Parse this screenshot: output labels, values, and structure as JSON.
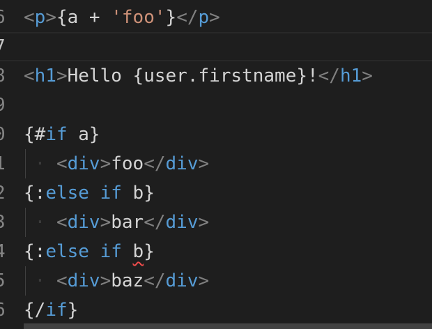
{
  "editor": {
    "lines": [
      {
        "num": "6",
        "tokens": [
          {
            "t": "<",
            "c": "tag"
          },
          {
            "t": "p",
            "c": "tagname"
          },
          {
            "t": ">",
            "c": "tag"
          },
          {
            "t": "{a + ",
            "c": "brace"
          },
          {
            "t": "'foo'",
            "c": "str"
          },
          {
            "t": "}",
            "c": "brace"
          },
          {
            "t": "</",
            "c": "tag"
          },
          {
            "t": "p",
            "c": "tagname"
          },
          {
            "t": ">",
            "c": "tag"
          }
        ]
      },
      {
        "num": "7",
        "current": true,
        "tokens": []
      },
      {
        "num": "8",
        "tokens": [
          {
            "t": "<",
            "c": "tag"
          },
          {
            "t": "h1",
            "c": "tagname"
          },
          {
            "t": ">",
            "c": "tag"
          },
          {
            "t": "Hello {user.firstname}!",
            "c": "brace"
          },
          {
            "t": "</",
            "c": "tag"
          },
          {
            "t": "h1",
            "c": "tagname"
          },
          {
            "t": ">",
            "c": "tag"
          }
        ]
      },
      {
        "num": "9",
        "tokens": []
      },
      {
        "num": "0",
        "tokens": [
          {
            "t": "{#",
            "c": "brace"
          },
          {
            "t": "if",
            "c": "kw"
          },
          {
            "t": " a}",
            "c": "brace"
          }
        ]
      },
      {
        "num": "1",
        "indent": true,
        "tokens": [
          {
            "t": "<",
            "c": "tag"
          },
          {
            "t": "div",
            "c": "tagname"
          },
          {
            "t": ">",
            "c": "tag"
          },
          {
            "t": "foo",
            "c": "brace"
          },
          {
            "t": "</",
            "c": "tag"
          },
          {
            "t": "div",
            "c": "tagname"
          },
          {
            "t": ">",
            "c": "tag"
          }
        ]
      },
      {
        "num": "2",
        "tokens": [
          {
            "t": "{:",
            "c": "brace"
          },
          {
            "t": "else if",
            "c": "kw"
          },
          {
            "t": " b}",
            "c": "brace"
          }
        ]
      },
      {
        "num": "3",
        "indent": true,
        "tokens": [
          {
            "t": "<",
            "c": "tag"
          },
          {
            "t": "div",
            "c": "tagname"
          },
          {
            "t": ">",
            "c": "tag"
          },
          {
            "t": "bar",
            "c": "brace"
          },
          {
            "t": "</",
            "c": "tag"
          },
          {
            "t": "div",
            "c": "tagname"
          },
          {
            "t": ">",
            "c": "tag"
          }
        ]
      },
      {
        "num": "4",
        "tokens": [
          {
            "t": "{:",
            "c": "brace"
          },
          {
            "t": "else if",
            "c": "kw"
          },
          {
            "t": " ",
            "c": "brace"
          },
          {
            "t": "b",
            "c": "brace",
            "squiggle": true
          },
          {
            "t": "}",
            "c": "brace"
          }
        ]
      },
      {
        "num": "5",
        "indent": true,
        "tokens": [
          {
            "t": "<",
            "c": "tag"
          },
          {
            "t": "div",
            "c": "tagname"
          },
          {
            "t": ">",
            "c": "tag"
          },
          {
            "t": "baz",
            "c": "brace"
          },
          {
            "t": "</",
            "c": "tag"
          },
          {
            "t": "div",
            "c": "tagname"
          },
          {
            "t": ">",
            "c": "tag"
          }
        ]
      },
      {
        "num": "6",
        "tokens": [
          {
            "t": "{/",
            "c": "brace"
          },
          {
            "t": "if",
            "c": "kw"
          },
          {
            "t": "}",
            "c": "brace"
          }
        ]
      }
    ]
  },
  "colors": {
    "background": "#1e1e1e",
    "tag_punct": "#808080",
    "tag_name": "#569cd6",
    "keyword": "#569cd6",
    "string": "#ce9178",
    "text": "#d4d4d4",
    "line_number": "#858585",
    "error_squiggle": "#f14c4c"
  }
}
